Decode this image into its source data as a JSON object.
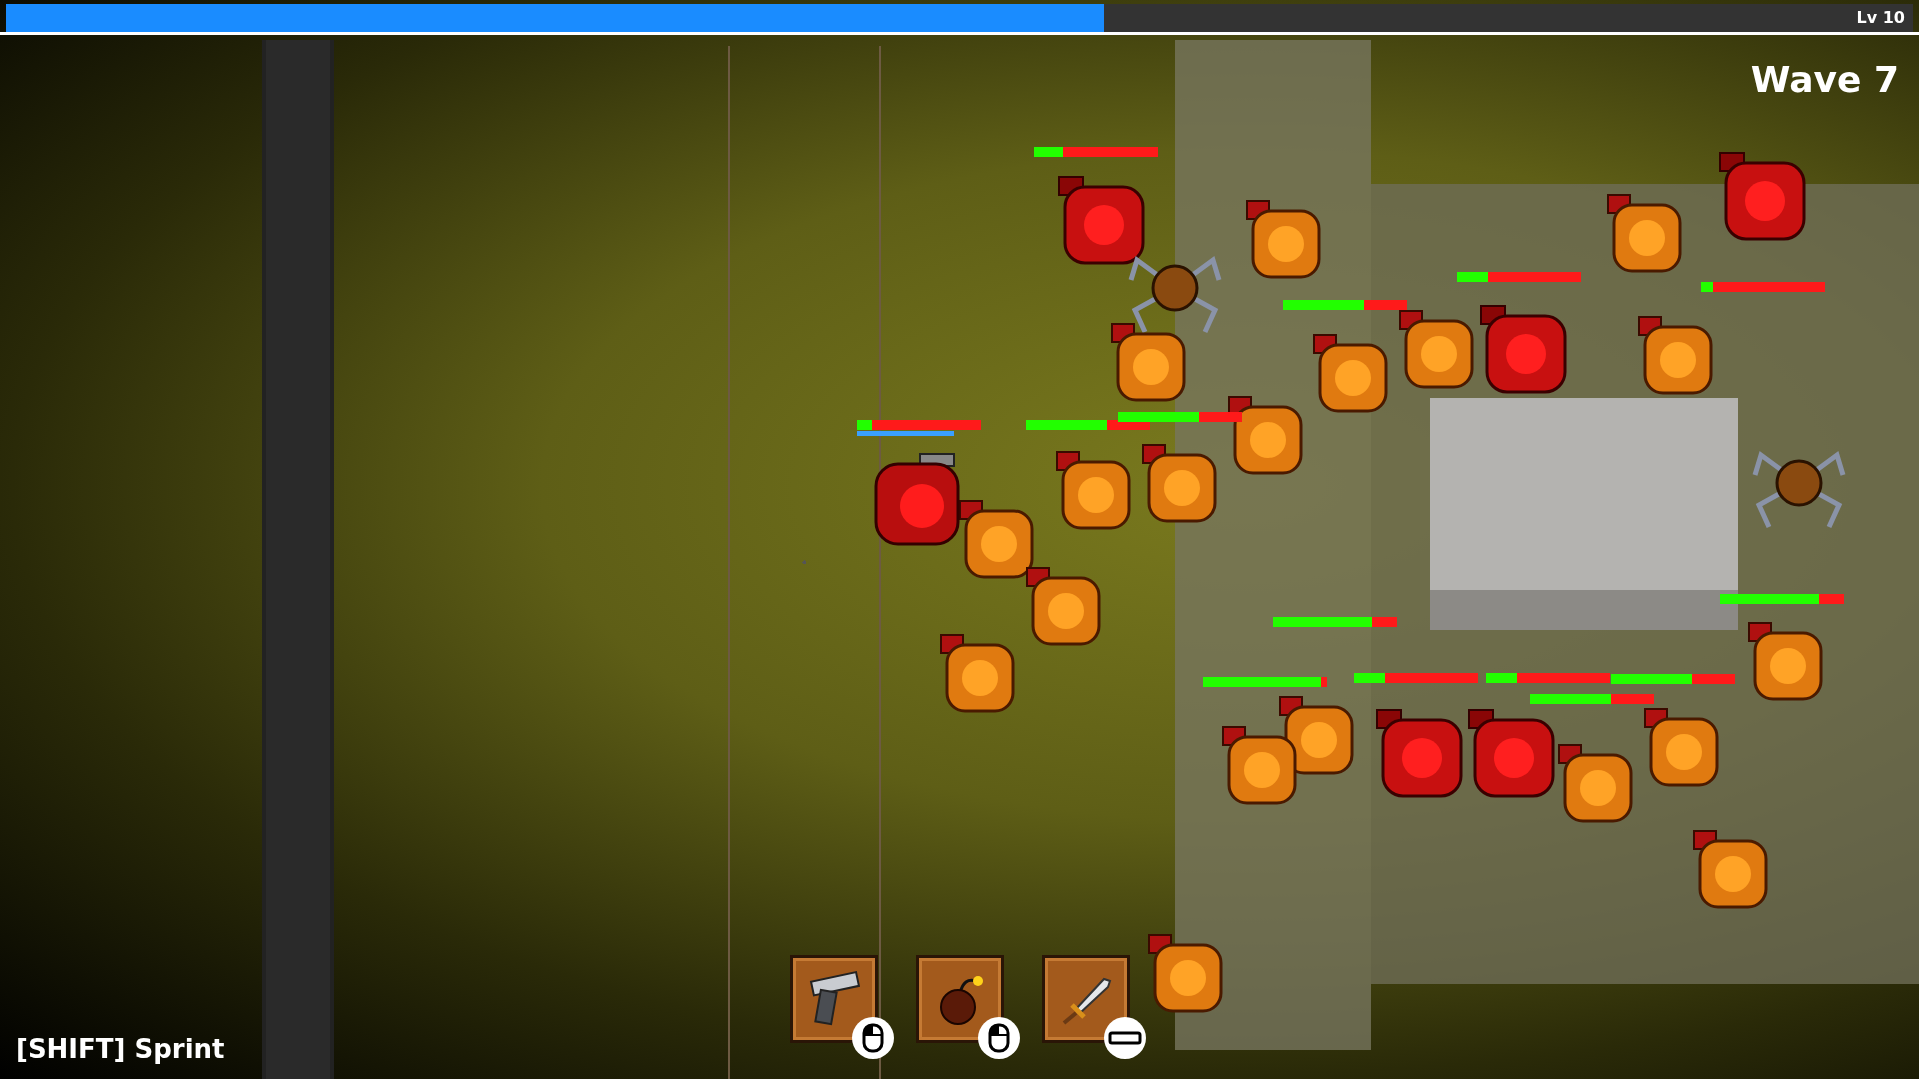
{
  "xp_bar": {
    "level": 0.576,
    "label": "Lv 10"
  },
  "wave": "Wave 7",
  "player": {
    "health_bar": {
      "level": 0.12
    },
    "stamina_bar": {
      "level": 0.78
    }
  },
  "enemies": [
    {
      "kind": "brute",
      "health_bar": {
        "level": 0.23
      }
    },
    {
      "kind": "spider"
    },
    {
      "kind": "grunt"
    },
    {
      "kind": "grunt",
      "health_bar": {
        "level": 0.65
      }
    },
    {
      "kind": "grunt"
    },
    {
      "kind": "brute",
      "health_bar": {
        "level": 0.25
      }
    },
    {
      "kind": "grunt"
    },
    {
      "kind": "grunt",
      "health_bar": {
        "level": 0.1
      }
    },
    {
      "kind": "brute"
    },
    {
      "kind": "grunt",
      "health_bar": {
        "level": 0.65
      }
    },
    {
      "kind": "grunt",
      "health_bar": {
        "level": 0.65
      }
    },
    {
      "kind": "grunt"
    },
    {
      "kind": "grunt"
    },
    {
      "kind": "grunt"
    },
    {
      "kind": "grunt"
    },
    {
      "kind": "grunt"
    },
    {
      "kind": "grunt",
      "health_bar": {
        "level": 0.95
      }
    },
    {
      "kind": "grunt",
      "health_bar": {
        "level": 0.8
      }
    },
    {
      "kind": "brute",
      "health_bar": {
        "level": 0.25
      }
    },
    {
      "kind": "brute",
      "health_bar": {
        "level": 0.25
      }
    },
    {
      "kind": "grunt",
      "health_bar": {
        "level": 0.65
      }
    },
    {
      "kind": "grunt",
      "health_bar": {
        "level": 0.65
      }
    },
    {
      "kind": "grunt",
      "health_bar": {
        "level": 0.8
      }
    },
    {
      "kind": "grunt"
    },
    {
      "kind": "grunt"
    },
    {
      "kind": "spider"
    }
  ],
  "hotbar": [
    {
      "item": {
        "kind": "pistol"
      },
      "binding": {
        "kind": "mouse_left"
      }
    },
    {
      "item": {
        "kind": "bomb"
      },
      "binding": {
        "kind": "mouse_left"
      }
    },
    {
      "item": {
        "kind": "sword"
      },
      "binding": {
        "kind": "space"
      }
    }
  ],
  "hint": "[SHIFT] Sprint"
}
